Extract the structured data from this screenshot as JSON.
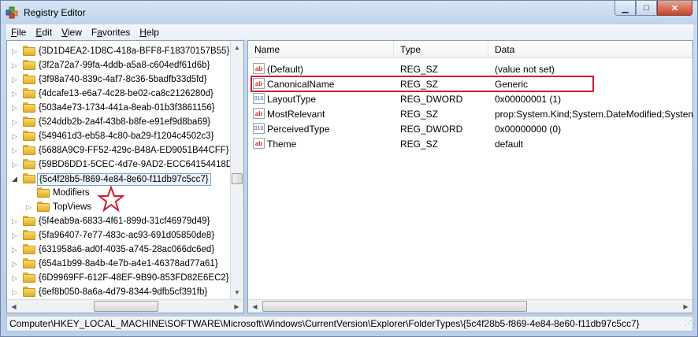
{
  "window": {
    "title": "Registry Editor"
  },
  "menu": [
    {
      "label": "File",
      "mnemonic": "F",
      "rest": "ile"
    },
    {
      "label": "Edit",
      "mnemonic": "E",
      "rest": "dit"
    },
    {
      "label": "View",
      "mnemonic": "V",
      "rest": "iew"
    },
    {
      "label": "Favorites",
      "mnemonic": "a",
      "before": "F",
      "rest": "vorites"
    },
    {
      "label": "Help",
      "mnemonic": "H",
      "rest": "elp"
    }
  ],
  "tree": {
    "items": [
      {
        "label": "{3D1D4EA2-1D8C-418a-BFF8-F18370157B55}",
        "level": 0,
        "expander": "collapsed"
      },
      {
        "label": "{3f2a72a7-99fa-4ddb-a5a8-c604edf61d6b}",
        "level": 0,
        "expander": "collapsed"
      },
      {
        "label": "{3f98a740-839c-4af7-8c36-5badfb33d5fd}",
        "level": 0,
        "expander": "collapsed"
      },
      {
        "label": "{4dcafe13-e6a7-4c28-be02-ca8c2126280d}",
        "level": 0,
        "expander": "collapsed"
      },
      {
        "label": "{503a4e73-1734-441a-8eab-01b3f3861156}",
        "level": 0,
        "expander": "collapsed"
      },
      {
        "label": "{524ddb2b-2a4f-43b8-b8fe-e91ef9d8ba69}",
        "level": 0,
        "expander": "collapsed"
      },
      {
        "label": "{549461d3-eb58-4c80-ba29-f1204c4502c3}",
        "level": 0,
        "expander": "collapsed"
      },
      {
        "label": "{5688A9C9-FF52-429c-B48A-ED9051B44CFF}",
        "level": 0,
        "expander": "collapsed"
      },
      {
        "label": "{59BD6DD1-5CEC-4d7e-9AD2-ECC64154418D}",
        "level": 0,
        "expander": "collapsed"
      },
      {
        "label": "{5c4f28b5-f869-4e84-8e60-f11db97c5cc7}",
        "level": 0,
        "expander": "expanded",
        "selected": true
      },
      {
        "label": "Modifiers",
        "level": 1,
        "expander": "none"
      },
      {
        "label": "TopViews",
        "level": 1,
        "expander": "collapsed"
      },
      {
        "label": "{5f4eab9a-6833-4f61-899d-31cf46979d49}",
        "level": 0,
        "expander": "collapsed"
      },
      {
        "label": "{5fa96407-7e77-483c-ac93-691d05850de8}",
        "level": 0,
        "expander": "collapsed"
      },
      {
        "label": "{631958a6-ad0f-4035-a745-28ac066dc6ed}",
        "level": 0,
        "expander": "collapsed"
      },
      {
        "label": "{654a1b99-8a4b-4e7b-a4e1-46378ad77a61}",
        "level": 0,
        "expander": "collapsed"
      },
      {
        "label": "{6D9969FF-612F-48EF-9B90-853FD82E6EC2}",
        "level": 0,
        "expander": "collapsed"
      },
      {
        "label": "{6ef8b050-8a6a-4d79-8344-9dfb5cf391fb}",
        "level": 0,
        "expander": "collapsed"
      }
    ]
  },
  "list": {
    "columns": [
      "Name",
      "Type",
      "Data"
    ],
    "rows": [
      {
        "icon": "string-value-icon",
        "icon_text": "ab",
        "name": "(Default)",
        "type": "REG_SZ",
        "data": "(value not set)"
      },
      {
        "icon": "string-value-icon",
        "icon_text": "ab",
        "name": "CanonicalName",
        "type": "REG_SZ",
        "data": "Generic",
        "highlighted": true
      },
      {
        "icon": "dword-value-icon",
        "icon_text": "010",
        "name": "LayoutType",
        "type": "REG_DWORD",
        "data": "0x00000001 (1)"
      },
      {
        "icon": "string-value-icon",
        "icon_text": "ab",
        "name": "MostRelevant",
        "type": "REG_SZ",
        "data": "prop:System.Kind;System.DateModified;System"
      },
      {
        "icon": "dword-value-icon",
        "icon_text": "010",
        "name": "PerceivedType",
        "type": "REG_DWORD",
        "data": "0x00000000 (0)"
      },
      {
        "icon": "string-value-icon",
        "icon_text": "ab",
        "name": "Theme",
        "type": "REG_SZ",
        "data": "default"
      }
    ]
  },
  "status": {
    "path": "Computer\\HKEY_LOCAL_MACHINE\\SOFTWARE\\Microsoft\\Windows\\CurrentVersion\\Explorer\\FolderTypes\\{5c4f28b5-f869-4e84-8e60-f11db97c5cc7}"
  },
  "colors": {
    "highlight_box": "#d0202b",
    "star_outline": "#d0202b",
    "folder": "#f2c94c"
  }
}
